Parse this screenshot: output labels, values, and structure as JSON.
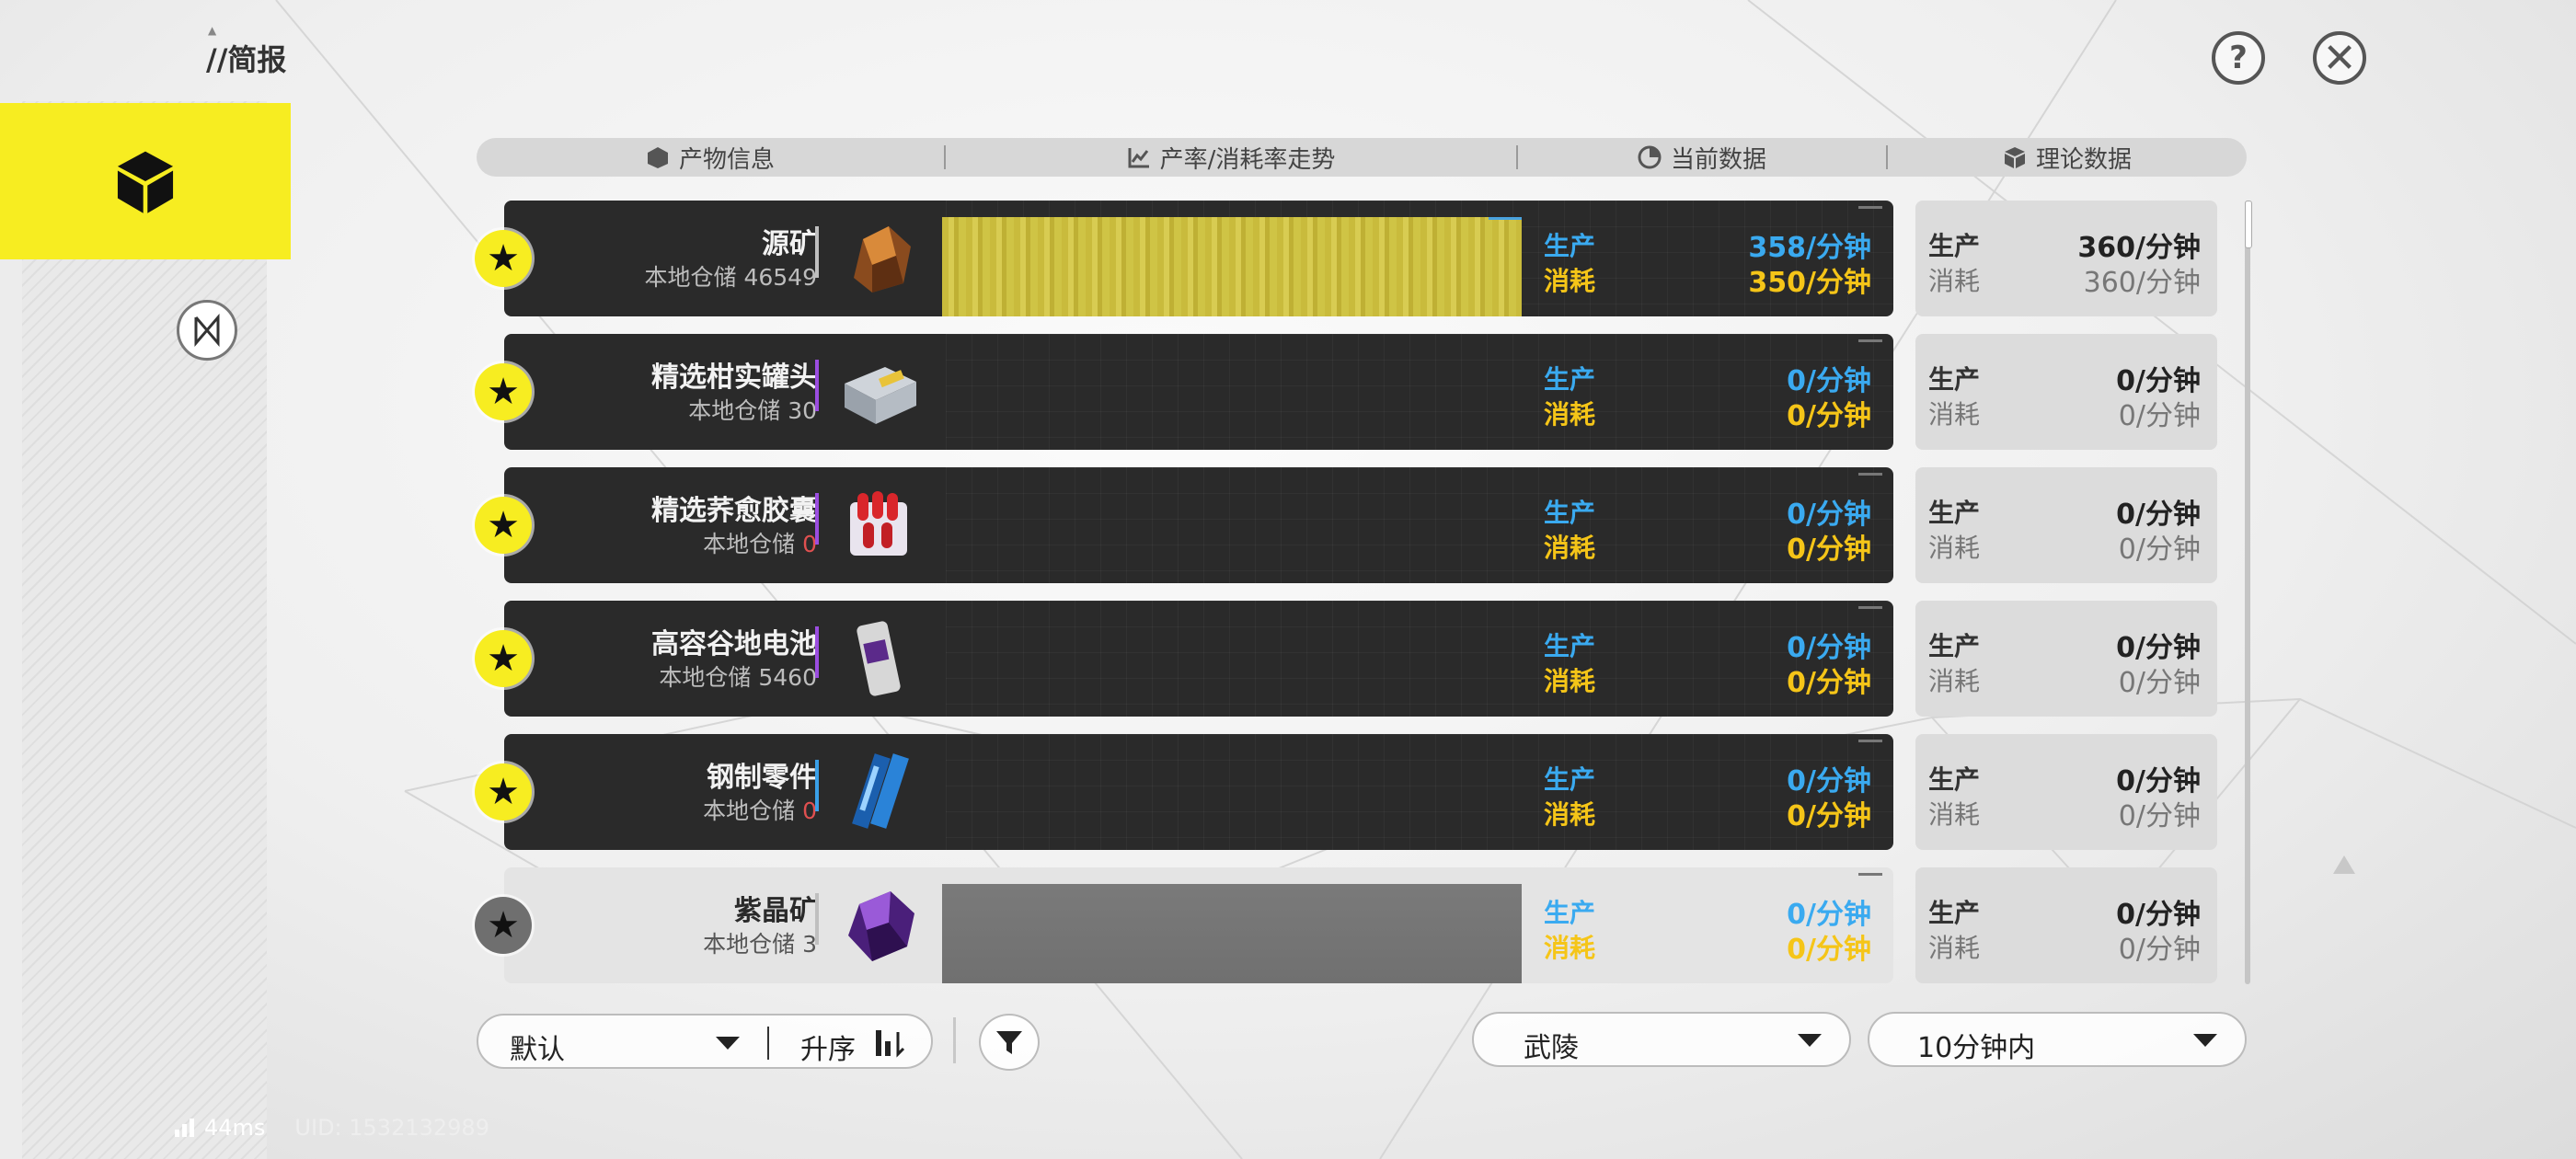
{
  "header_small_logo": "▲",
  "title": "//简报",
  "top_buttons": {
    "help_icon": "?",
    "close_icon": "✕"
  },
  "columns": [
    {
      "label": "产物信息",
      "icon": "item-icon"
    },
    {
      "label": "产率/消耗率走势",
      "icon": "chart-icon"
    },
    {
      "label": "当前数据",
      "icon": "pie-icon"
    },
    {
      "label": "理论数据",
      "icon": "cube-icon"
    }
  ],
  "labels": {
    "production": "生产",
    "consumption": "消耗"
  },
  "rows": [
    {
      "name": "源矿",
      "storage_prefix": "本地仓储 ",
      "storage_value": "46549",
      "starred": true,
      "accent": "#bfbfbf",
      "trend": "gold",
      "current_production": "358/分钟",
      "current_consumption": "350/分钟",
      "theory_production": "360/分钟",
      "theory_consumption": "360/分钟"
    },
    {
      "name": "精选柑实罐头",
      "storage_prefix": "本地仓储 ",
      "storage_value": "30",
      "starred": true,
      "accent": "#9b4de0",
      "trend": "none",
      "current_production": "0/分钟",
      "current_consumption": "0/分钟",
      "theory_production": "0/分钟",
      "theory_consumption": "0/分钟"
    },
    {
      "name": "精选荞愈胶囊",
      "storage_prefix": "本地仓储 ",
      "storage_value": "0",
      "starred": true,
      "accent": "#9b4de0",
      "trend": "none",
      "current_production": "0/分钟",
      "current_consumption": "0/分钟",
      "theory_production": "0/分钟",
      "theory_consumption": "0/分钟"
    },
    {
      "name": "高容谷地电池",
      "storage_prefix": "本地仓储 ",
      "storage_value": "5460",
      "starred": true,
      "accent": "#9b4de0",
      "trend": "none",
      "current_production": "0/分钟",
      "current_consumption": "0/分钟",
      "theory_production": "0/分钟",
      "theory_consumption": "0/分钟"
    },
    {
      "name": "钢制零件",
      "storage_prefix": "本地仓储 ",
      "storage_value": "0",
      "starred": true,
      "accent": "#3aa0e8",
      "trend": "none",
      "current_production": "0/分钟",
      "current_consumption": "0/分钟",
      "theory_production": "0/分钟",
      "theory_consumption": "0/分钟"
    },
    {
      "name": "紫晶矿",
      "storage_prefix": "本地仓储 ",
      "storage_value": "3",
      "starred": false,
      "accent": "#bfbfbf",
      "trend": "gray",
      "current_production": "0/分钟",
      "current_consumption": "0/分钟",
      "theory_production": "0/分钟",
      "theory_consumption": "0/分钟"
    }
  ],
  "footer": {
    "sort_default": "默认",
    "sort_order": "升序",
    "region": "武陵",
    "time_range": "10分钟内"
  },
  "status": {
    "ping": "44ms",
    "uid": "UID: 1532132989"
  },
  "colors": {
    "accent_yellow": "#f7ed21",
    "production_blue": "#3aaaf0",
    "consumption_yellow": "#f5c518",
    "row_dark": "#2a2a2a"
  }
}
